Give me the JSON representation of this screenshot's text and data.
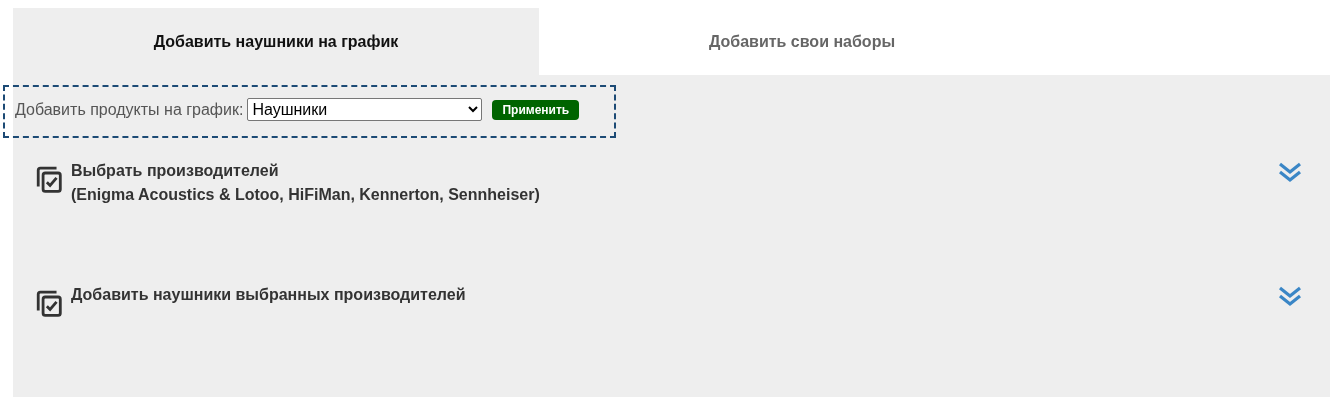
{
  "tabs": [
    {
      "label": "Добавить наушники на график",
      "selected": true
    },
    {
      "label": "Добавить свои наборы",
      "selected": false
    }
  ],
  "add_bar": {
    "label": "Добавить продукты на график:",
    "select": {
      "value": "Наушники"
    },
    "apply_button": "Применить"
  },
  "sections": [
    {
      "title": "Выбрать производителей",
      "subtitle": "(Enigma Acoustics & Lotoo, HiFiMan, Kennerton, Sennheiser)",
      "expanded": false
    },
    {
      "title": "Добавить наушники выбранных производителей",
      "expanded": false
    }
  ]
}
